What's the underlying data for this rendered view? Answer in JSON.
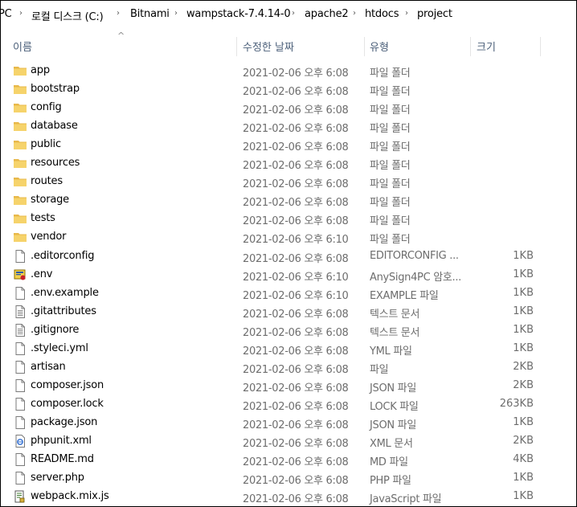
{
  "breadcrumb": [
    "PC",
    "로컬 디스크 (C:)",
    "Bitnami",
    "wampstack-7.4.14-0",
    "apache2",
    "htdocs",
    "project"
  ],
  "columns": {
    "name": "이름",
    "date": "수정한 날짜",
    "type": "유형",
    "size": "크기"
  },
  "files": [
    {
      "name": "app",
      "date": "2021-02-06 오후 6:08",
      "type": "파일 폴더",
      "size": "",
      "icon": "folder-icon"
    },
    {
      "name": "bootstrap",
      "date": "2021-02-06 오후 6:08",
      "type": "파일 폴더",
      "size": "",
      "icon": "folder-icon"
    },
    {
      "name": "config",
      "date": "2021-02-06 오후 6:08",
      "type": "파일 폴더",
      "size": "",
      "icon": "folder-icon"
    },
    {
      "name": "database",
      "date": "2021-02-06 오후 6:08",
      "type": "파일 폴더",
      "size": "",
      "icon": "folder-icon"
    },
    {
      "name": "public",
      "date": "2021-02-06 오후 6:08",
      "type": "파일 폴더",
      "size": "",
      "icon": "folder-icon"
    },
    {
      "name": "resources",
      "date": "2021-02-06 오후 6:08",
      "type": "파일 폴더",
      "size": "",
      "icon": "folder-icon"
    },
    {
      "name": "routes",
      "date": "2021-02-06 오후 6:08",
      "type": "파일 폴더",
      "size": "",
      "icon": "folder-icon"
    },
    {
      "name": "storage",
      "date": "2021-02-06 오후 6:08",
      "type": "파일 폴더",
      "size": "",
      "icon": "folder-icon"
    },
    {
      "name": "tests",
      "date": "2021-02-06 오후 6:08",
      "type": "파일 폴더",
      "size": "",
      "icon": "folder-icon"
    },
    {
      "name": "vendor",
      "date": "2021-02-06 오후 6:10",
      "type": "파일 폴더",
      "size": "",
      "icon": "folder-icon"
    },
    {
      "name": ".editorconfig",
      "date": "2021-02-06 오후 6:08",
      "type": "EDITORCONFIG ...",
      "size": "1KB",
      "icon": "file-icon"
    },
    {
      "name": ".env",
      "date": "2021-02-06 오후 6:10",
      "type": "AnySign4PC 암호...",
      "size": "1KB",
      "icon": "certificate-file-icon"
    },
    {
      "name": ".env.example",
      "date": "2021-02-06 오후 6:10",
      "type": "EXAMPLE 파일",
      "size": "1KB",
      "icon": "file-icon"
    },
    {
      "name": ".gitattributes",
      "date": "2021-02-06 오후 6:08",
      "type": "텍스트 문서",
      "size": "1KB",
      "icon": "text-file-icon"
    },
    {
      "name": ".gitignore",
      "date": "2021-02-06 오후 6:08",
      "type": "텍스트 문서",
      "size": "1KB",
      "icon": "text-file-icon"
    },
    {
      "name": ".styleci.yml",
      "date": "2021-02-06 오후 6:08",
      "type": "YML 파일",
      "size": "1KB",
      "icon": "file-icon"
    },
    {
      "name": "artisan",
      "date": "2021-02-06 오후 6:08",
      "type": "파일",
      "size": "2KB",
      "icon": "file-icon"
    },
    {
      "name": "composer.json",
      "date": "2021-02-06 오후 6:08",
      "type": "JSON 파일",
      "size": "2KB",
      "icon": "file-icon"
    },
    {
      "name": "composer.lock",
      "date": "2021-02-06 오후 6:08",
      "type": "LOCK 파일",
      "size": "263KB",
      "icon": "file-icon"
    },
    {
      "name": "package.json",
      "date": "2021-02-06 오후 6:08",
      "type": "JSON 파일",
      "size": "1KB",
      "icon": "file-icon"
    },
    {
      "name": "phpunit.xml",
      "date": "2021-02-06 오후 6:08",
      "type": "XML 문서",
      "size": "2KB",
      "icon": "xml-file-icon"
    },
    {
      "name": "README.md",
      "date": "2021-02-06 오후 6:08",
      "type": "MD 파일",
      "size": "4KB",
      "icon": "file-icon"
    },
    {
      "name": "server.php",
      "date": "2021-02-06 오후 6:08",
      "type": "PHP 파일",
      "size": "1KB",
      "icon": "file-icon"
    },
    {
      "name": "webpack.mix.js",
      "date": "2021-02-06 오후 6:08",
      "type": "JavaScript 파일",
      "size": "1KB",
      "icon": "script-file-icon"
    }
  ]
}
